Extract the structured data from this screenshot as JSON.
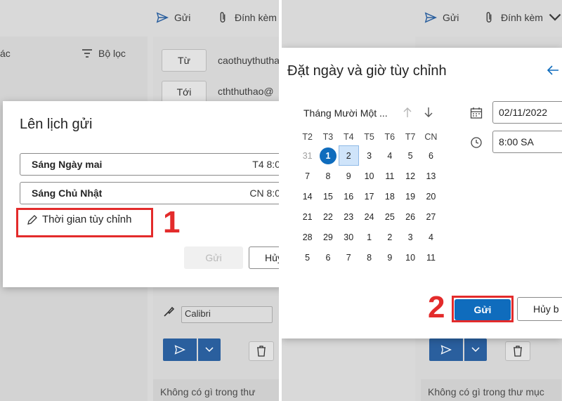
{
  "toolbar": {
    "send_label": "Gửi",
    "attach_label": "Đính kèm"
  },
  "left_bg": {
    "partial_text": "ác",
    "filter_label": "Bộ lọc",
    "from_button": "Từ",
    "to_button": "Tới",
    "from_value": "caothuythutha",
    "to_value": "cththuthao@",
    "font_value": "Calibri",
    "empty_text": "Không có gì trong thư mục"
  },
  "schedule_dialog": {
    "title": "Lên lịch gửi",
    "options": [
      {
        "label": "Sáng Ngày mai",
        "right": "T4 8:0"
      },
      {
        "label": "Sáng Chủ Nhật",
        "right": "CN 8:0"
      }
    ],
    "custom_time": "Thời gian tùy chỉnh",
    "send": "Gửi",
    "cancel": "Hủy"
  },
  "right_bg": {
    "empty_text": "Không có gì trong thư mục"
  },
  "custom_dialog": {
    "title": "Đặt ngày và giờ tùy chỉnh",
    "month": "Tháng Mười Một ...",
    "weekdays": [
      "T2",
      "T3",
      "T4",
      "T5",
      "T6",
      "T7",
      "CN"
    ],
    "weeks": [
      [
        "31",
        "1",
        "2",
        "3",
        "4",
        "5",
        "6"
      ],
      [
        "7",
        "8",
        "9",
        "10",
        "11",
        "12",
        "13"
      ],
      [
        "14",
        "15",
        "16",
        "17",
        "18",
        "19",
        "20"
      ],
      [
        "21",
        "22",
        "23",
        "24",
        "25",
        "26",
        "27"
      ],
      [
        "28",
        "29",
        "30",
        "1",
        "2",
        "3",
        "4"
      ],
      [
        "5",
        "6",
        "7",
        "8",
        "9",
        "10",
        "11"
      ]
    ],
    "date_value": "02/11/2022",
    "time_value": "8:00 SA",
    "send": "Gửi",
    "cancel": "Hủy b"
  },
  "annotations": {
    "step1": "1",
    "step2": "2"
  },
  "colors": {
    "accent": "#0f6cbd",
    "highlight": "#e32b2b"
  }
}
